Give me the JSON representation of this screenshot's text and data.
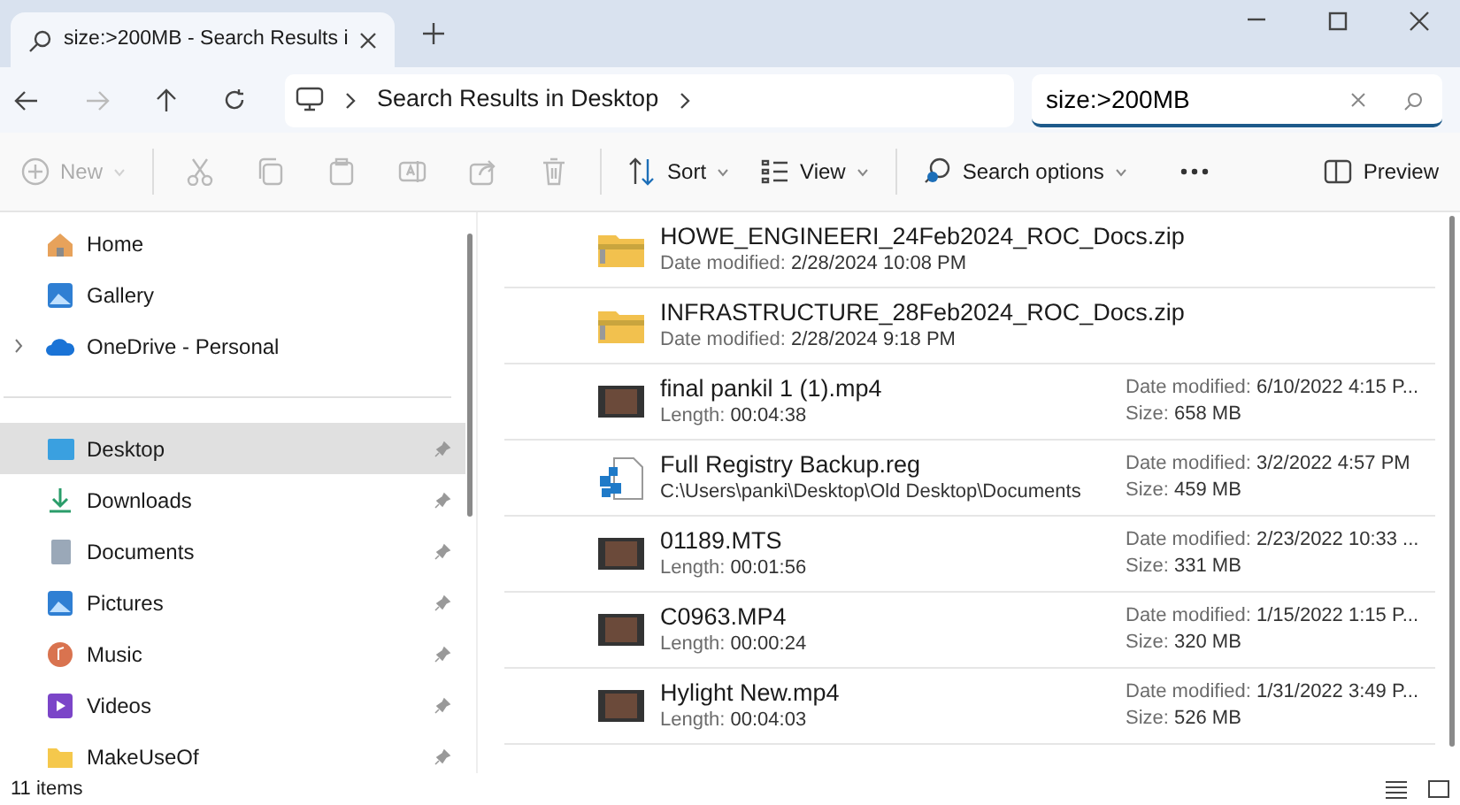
{
  "tab": {
    "title": "size:>200MB - Search Results i"
  },
  "address_bar": {
    "location": "Search Results in Desktop"
  },
  "search": {
    "value": "size:>200MB"
  },
  "command_bar": [
    {
      "kind": "new",
      "label": "New",
      "disabled": true
    },
    {
      "kind": "cut",
      "disabled": true
    },
    {
      "kind": "copy",
      "disabled": true
    },
    {
      "kind": "paste",
      "disabled": true
    },
    {
      "kind": "rename",
      "disabled": true
    },
    {
      "kind": "share",
      "disabled": true
    },
    {
      "kind": "delete",
      "disabled": true
    },
    {
      "kind": "sort",
      "label": "Sort",
      "disabled": false
    },
    {
      "kind": "view",
      "label": "View",
      "disabled": false
    },
    {
      "kind": "search_options",
      "label": "Search options",
      "disabled": false
    },
    {
      "kind": "more",
      "disabled": false
    },
    {
      "kind": "preview",
      "label": "Preview",
      "disabled": false
    }
  ],
  "sidebar": {
    "top": [
      {
        "kind": "home",
        "label": "Home",
        "expandable": false,
        "selected": false
      },
      {
        "kind": "gallery",
        "label": "Gallery",
        "expandable": false,
        "selected": false
      },
      {
        "kind": "cloud",
        "label": "OneDrive - Personal",
        "expandable": true,
        "selected": false
      }
    ],
    "pinned": [
      {
        "kind": "desktop",
        "label": "Desktop",
        "selected": true
      },
      {
        "kind": "downloads",
        "label": "Downloads",
        "selected": false
      },
      {
        "kind": "documents",
        "label": "Documents",
        "selected": false
      },
      {
        "kind": "pictures",
        "label": "Pictures",
        "selected": false
      },
      {
        "kind": "music",
        "label": "Music",
        "selected": false
      },
      {
        "kind": "videos",
        "label": "Videos",
        "selected": false
      },
      {
        "kind": "folder",
        "label": "MakeUseOf",
        "selected": false
      }
    ]
  },
  "files": [
    {
      "kind": "zip",
      "name": "HOWE_ENGINEERI_24Feb2024_ROC_Docs.zip",
      "sub": {
        "label": "Date modified:",
        "value": "2/28/2024 10:08 PM"
      }
    },
    {
      "kind": "zip",
      "name": "INFRASTRUCTURE_28Feb2024_ROC_Docs.zip",
      "sub": {
        "label": "Date modified:",
        "value": "2/28/2024 9:18 PM"
      }
    },
    {
      "kind": "video",
      "name": "final pankil 1 (1).mp4",
      "sub": {
        "label": "Length:",
        "value": "00:04:38"
      },
      "right": [
        {
          "label": "Date modified:",
          "value": "6/10/2022 4:15 P..."
        },
        {
          "label": "Size:",
          "value": "658 MB"
        }
      ]
    },
    {
      "kind": "reg",
      "name": "Full Registry Backup.reg",
      "sub": {
        "value": "C:\\Users\\panki\\Desktop\\Old Desktop\\Documents"
      },
      "right": [
        {
          "label": "Date modified:",
          "value": "3/2/2022 4:57 PM"
        },
        {
          "label": "Size:",
          "value": "459 MB"
        }
      ]
    },
    {
      "kind": "video",
      "name": "01189.MTS",
      "sub": {
        "label": "Length:",
        "value": "00:01:56"
      },
      "right": [
        {
          "label": "Date modified:",
          "value": "2/23/2022 10:33 ..."
        },
        {
          "label": "Size:",
          "value": "331 MB"
        }
      ]
    },
    {
      "kind": "video",
      "name": "C0963.MP4",
      "sub": {
        "label": "Length:",
        "value": "00:00:24"
      },
      "right": [
        {
          "label": "Date modified:",
          "value": "1/15/2022 1:15 P..."
        },
        {
          "label": "Size:",
          "value": "320 MB"
        }
      ]
    },
    {
      "kind": "video",
      "name": "Hylight New.mp4",
      "sub": {
        "label": "Length:",
        "value": "00:04:03"
      },
      "right": [
        {
          "label": "Date modified:",
          "value": "1/31/2022 3:49 P..."
        },
        {
          "label": "Size:",
          "value": "526 MB"
        }
      ]
    }
  ],
  "status_bar": {
    "count": "11 items"
  }
}
